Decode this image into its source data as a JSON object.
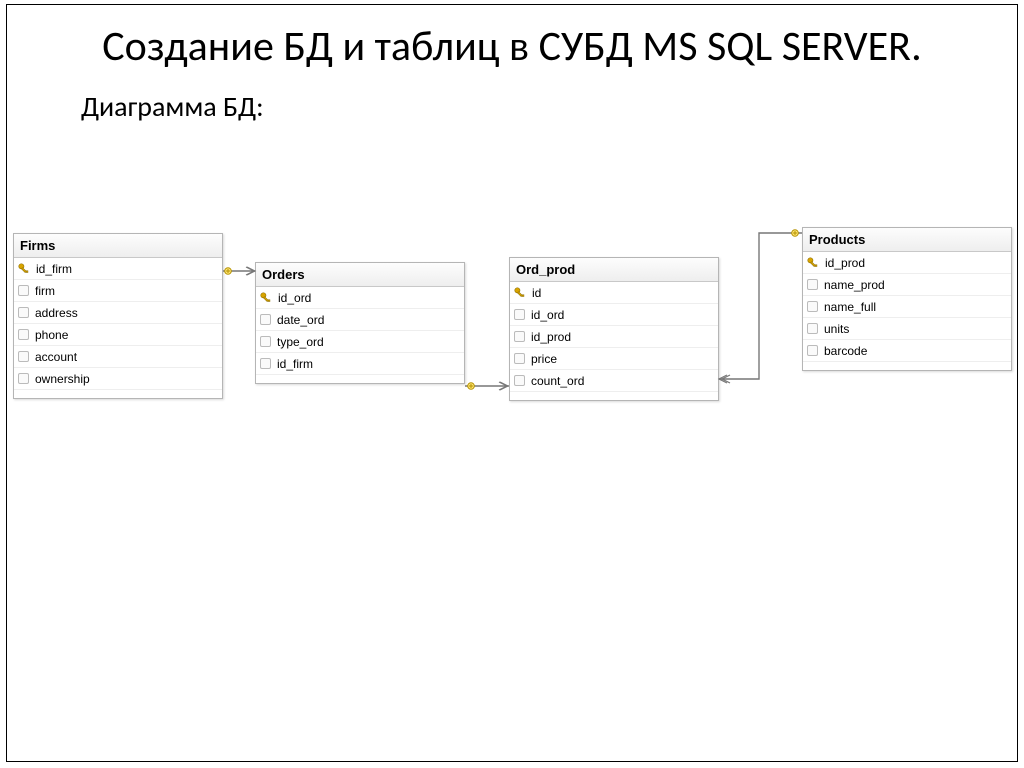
{
  "slide": {
    "title": "Создание БД и таблиц в СУБД MS SQL SERVER.",
    "subtitle": "Диаграмма БД:"
  },
  "tables": {
    "firms": {
      "name": "Firms",
      "columns": [
        {
          "name": "id_firm",
          "pk": true
        },
        {
          "name": "firm",
          "pk": false
        },
        {
          "name": "address",
          "pk": false
        },
        {
          "name": "phone",
          "pk": false
        },
        {
          "name": "account",
          "pk": false
        },
        {
          "name": "ownership",
          "pk": false
        }
      ]
    },
    "orders": {
      "name": "Orders",
      "columns": [
        {
          "name": "id_ord",
          "pk": true
        },
        {
          "name": "date_ord",
          "pk": false
        },
        {
          "name": "type_ord",
          "pk": false
        },
        {
          "name": "id_firm",
          "pk": false
        }
      ]
    },
    "ord_prod": {
      "name": "Ord_prod",
      "columns": [
        {
          "name": "id",
          "pk": true
        },
        {
          "name": "id_ord",
          "pk": false
        },
        {
          "name": "id_prod",
          "pk": false
        },
        {
          "name": "price",
          "pk": false
        },
        {
          "name": "count_ord",
          "pk": false
        }
      ]
    },
    "products": {
      "name": "Products",
      "columns": [
        {
          "name": "id_prod",
          "pk": true
        },
        {
          "name": "name_prod",
          "pk": false
        },
        {
          "name": "name_full",
          "pk": false
        },
        {
          "name": "units",
          "pk": false
        },
        {
          "name": "barcode",
          "pk": false
        }
      ]
    }
  }
}
